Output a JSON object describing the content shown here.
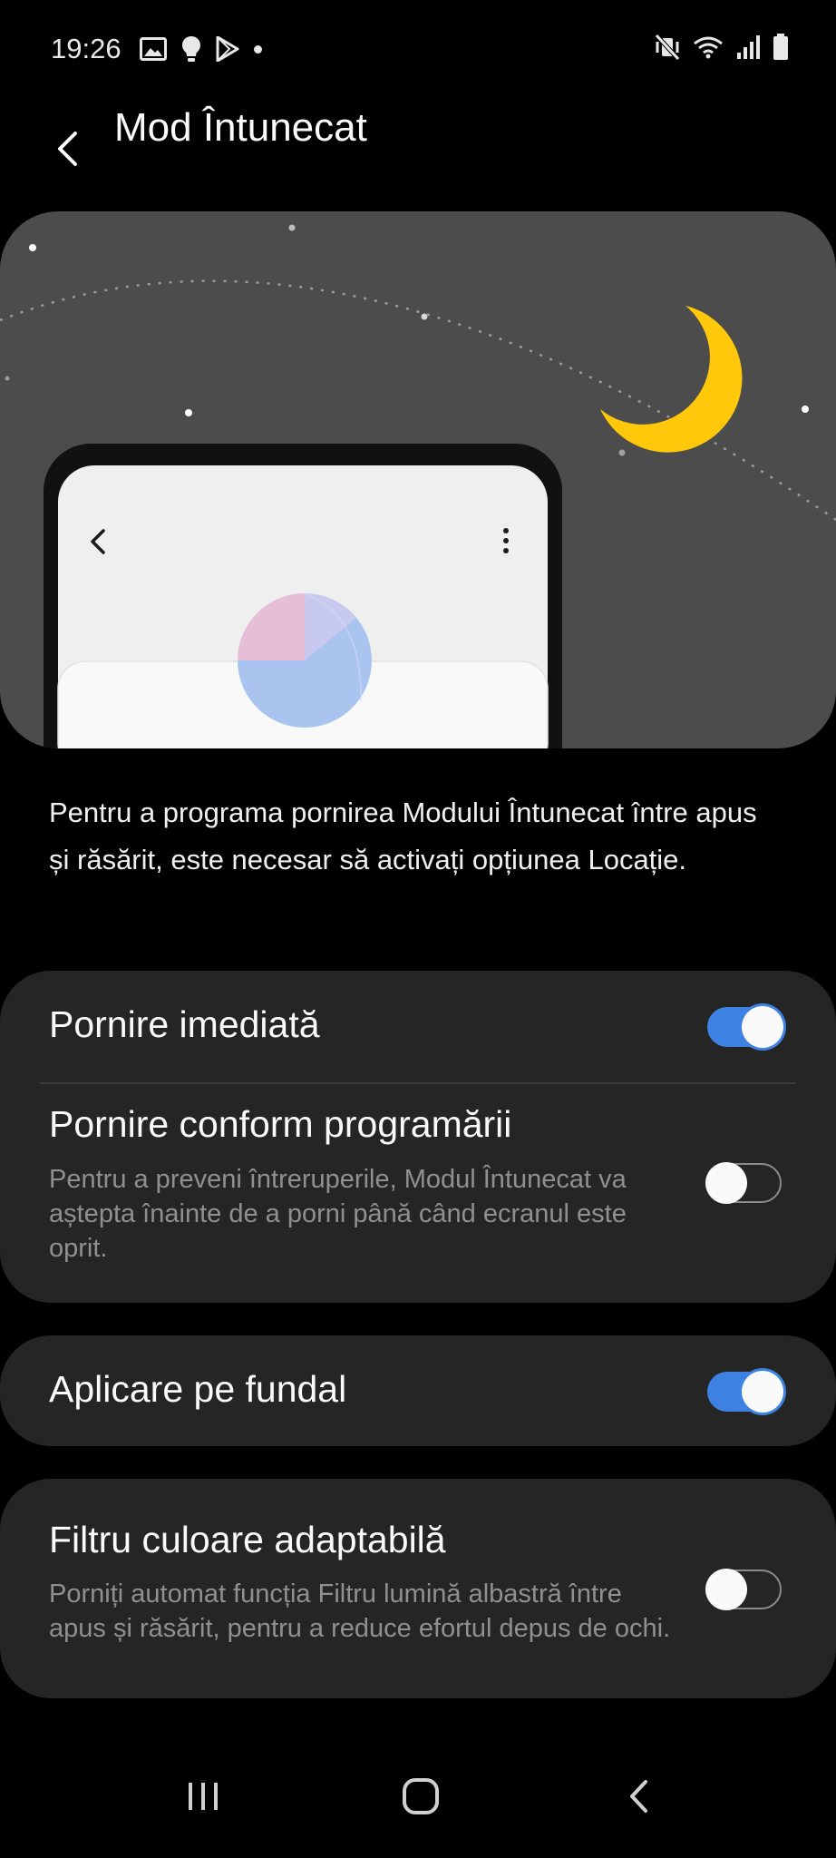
{
  "status_bar": {
    "time": "19:26",
    "left_icons": [
      "image-icon",
      "bulb-icon",
      "play-store-icon",
      "dot-icon"
    ],
    "right_icons": [
      "mute-vibrate-icon",
      "wifi-icon",
      "signal-icon",
      "battery-icon"
    ]
  },
  "header": {
    "title": "Mod Întunecat",
    "back_icon": "back-arrow-icon"
  },
  "illustration": {
    "moon_color": "#FFC80A",
    "bg_color": "#4C4C4C",
    "phone_icons": [
      "back-arrow-icon",
      "more-vert-icon"
    ]
  },
  "description": "Pentru a programa pornirea Modului Întunecat între apus și răsărit, este necesar să activați opțiunea Locație.",
  "settings": {
    "immediate": {
      "title": "Pornire imediată",
      "enabled": true
    },
    "scheduled": {
      "title": "Pornire conform programării",
      "subtitle": "Pentru a preveni întreruperile, Modul Întunecat va aștepta înainte de a porni până când ecranul este oprit.",
      "enabled": false
    },
    "wallpaper": {
      "title": "Aplicare pe fundal",
      "enabled": true
    },
    "adaptive_filter": {
      "title": "Filtru culoare adaptabilă",
      "subtitle": "Porniți automat funcția Filtru lumină albastră între apus și răsărit, pentru a reduce efortul depus de ochi.",
      "enabled": false
    }
  },
  "colors": {
    "accent": "#3D82E2",
    "card": "#252525",
    "background": "#000000"
  },
  "nav_bar": {
    "buttons": [
      "recent-apps-icon",
      "home-icon",
      "back-icon"
    ]
  }
}
